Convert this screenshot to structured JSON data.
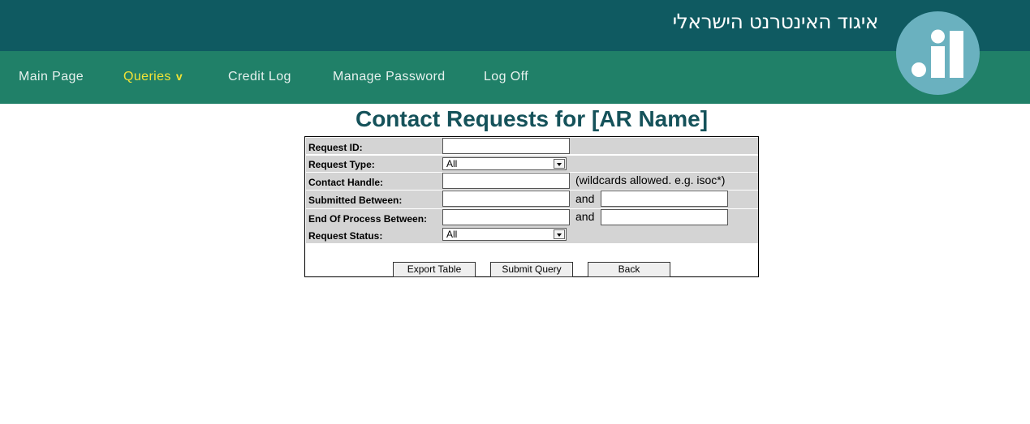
{
  "header": {
    "org_name": "איגוד האינטרנט הישראלי",
    "logo_text": ".il"
  },
  "nav": {
    "items": [
      {
        "label": "Main Page"
      },
      {
        "label": "Queries",
        "chevron": "v",
        "active": true
      },
      {
        "label": "Credit Log"
      },
      {
        "label": "Manage Password"
      },
      {
        "label": "Log Off"
      }
    ]
  },
  "page": {
    "title": "Contact Requests for [AR Name]"
  },
  "form": {
    "request_id": {
      "label": "Request ID:",
      "value": ""
    },
    "request_type": {
      "label": "Request Type:",
      "selected": "All"
    },
    "contact_handle": {
      "label": "Contact Handle:",
      "value": "",
      "hint": "(wildcards allowed. e.g. isoc*)"
    },
    "submitted_between": {
      "label": "Submitted Between:",
      "from": "",
      "and_label": "and",
      "to": ""
    },
    "end_of_process_between": {
      "label": "End Of Process Between:",
      "from": "",
      "and_label": "and",
      "to": ""
    },
    "request_status": {
      "label": "Request Status:",
      "selected": "All"
    }
  },
  "buttons": {
    "export": "Export Table",
    "submit": "Submit Query",
    "back": "Back"
  },
  "colors": {
    "header_bg": "#0f5a61",
    "nav_bg": "#208068",
    "nav_active": "#f2e335",
    "logo_bg": "#6ab1bf",
    "title": "#15525a",
    "row_bg": "#d4d4d4"
  }
}
